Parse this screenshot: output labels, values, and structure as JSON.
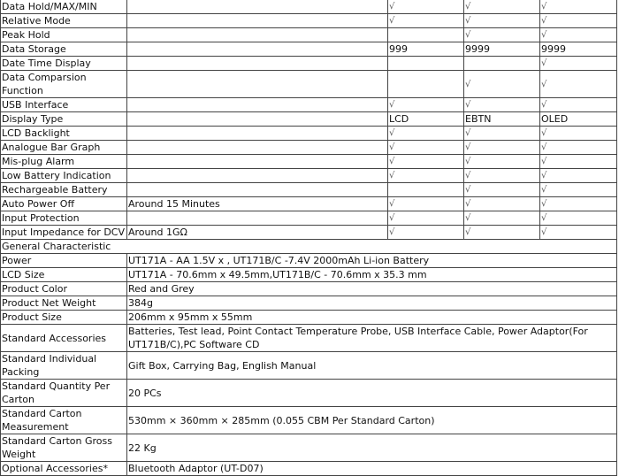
{
  "spec_table": {
    "rows": [
      {
        "label": "Data Hold/MAX/MIN",
        "value": "",
        "c1": "√",
        "c2": "√",
        "c3": "√"
      },
      {
        "label": "Relative Mode",
        "value": "",
        "c1": "√",
        "c2": "√",
        "c3": "√"
      },
      {
        "label": "Peak Hold",
        "value": "",
        "c1": "",
        "c2": "√",
        "c3": "√"
      },
      {
        "label": "Data Storage",
        "value": "",
        "c1": "999",
        "c2": "9999",
        "c3": "9999"
      },
      {
        "label": "Date Time Display",
        "value": "",
        "c1": "",
        "c2": "",
        "c3": "√"
      },
      {
        "label": "Data Comparsion Function",
        "value": "",
        "c1": "",
        "c2": "√",
        "c3": "√",
        "tall": true
      },
      {
        "label": "USB Interface",
        "value": "",
        "c1": "√",
        "c2": "√",
        "c3": "√"
      },
      {
        "label": "Display Type",
        "value": "",
        "c1": "LCD",
        "c2": "EBTN",
        "c3": "OLED"
      },
      {
        "label": "LCD Backlight",
        "value": "",
        "c1": "√",
        "c2": "√",
        "c3": "√"
      },
      {
        "label": "Analogue Bar Graph",
        "value": "",
        "c1": "√",
        "c2": "√",
        "c3": "√"
      },
      {
        "label": "Mis-plug Alarm",
        "value": "",
        "c1": "√",
        "c2": "√",
        "c3": "√"
      },
      {
        "label": "Low Battery Indication",
        "value": "",
        "c1": "√",
        "c2": "√",
        "c3": "√"
      },
      {
        "label": "Rechargeable Battery",
        "value": "",
        "c1": "",
        "c2": "√",
        "c3": "√"
      },
      {
        "label": "Auto Power Off",
        "value": "Around 15 Minutes",
        "c1": "√",
        "c2": "√",
        "c3": "√"
      },
      {
        "label": "Input Protection",
        "value": "",
        "c1": "√",
        "c2": "√",
        "c3": "√"
      },
      {
        "label": "Input Impedance for DCV",
        "value": "Around 1GΩ",
        "c1": "√",
        "c2": "√",
        "c3": "√"
      }
    ],
    "section_header": "General Characteristic",
    "general_rows": [
      {
        "label": "Power",
        "value": "UT171A - AA 1.5V x , UT171B/C -7.4V  2000mAh  Li-ion Battery"
      },
      {
        "label": "LCD Size",
        "value": "UT171A - 70.6mm x 49.5mm,UT171B/C - 70.6mm x 35.3 mm"
      },
      {
        "label": "Product Color",
        "value": "Red and Grey"
      },
      {
        "label": "Product Net Weight",
        "value": "384g"
      },
      {
        "label": "Product Size",
        "value": "206mm x 95mm x 55mm"
      },
      {
        "label": "Standard Accessories",
        "value": "Batteries, Test lead, Point Contact Temperature Probe, USB Interface Cable, Power Adaptor(For UT171B/C),PC Software CD",
        "tall": true
      },
      {
        "label": "Standard Individual Packing",
        "value": "Gift Box, Carrying Bag, English Manual",
        "tall": true
      },
      {
        "label": "Standard Quantity Per Carton",
        "value": "20 PCs",
        "tall": true
      },
      {
        "label": "Standard Carton Measurement",
        "value": "530mm × 360mm × 285mm (0.055 CBM Per Standard Carton)",
        "tall": true
      },
      {
        "label": "Standard Carton Gross Weight",
        "value": "22 Kg",
        "tall": true
      },
      {
        "label": "Optional Accessories*",
        "value": "Bluetooth Adaptor (UT-D07)"
      }
    ]
  }
}
